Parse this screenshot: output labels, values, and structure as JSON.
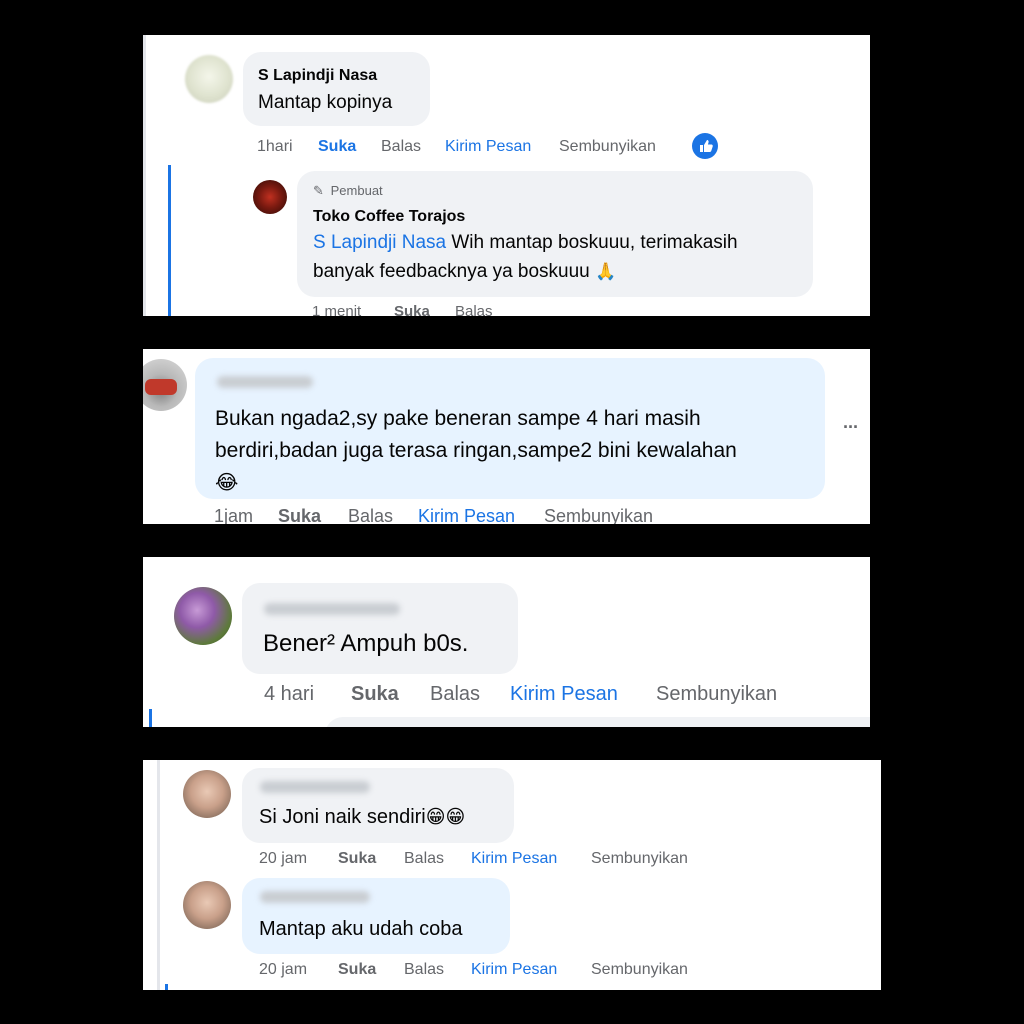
{
  "panel1": {
    "comment": {
      "author": "S Lapindji Nasa",
      "text": "Mantap kopinya",
      "actions": {
        "time": "1hari",
        "like": "Suka",
        "reply": "Balas",
        "message": "Kirim Pesan",
        "hide": "Sembunyikan"
      }
    },
    "reply": {
      "badge": "Pembuat",
      "author": "Toko Coffee Torajos",
      "mention": "S Lapindji Nasa",
      "text_line1": " Wih mantap boskuuu, terimakasih",
      "text_line2": "banyak feedbacknya ya boskuuu",
      "emoji": "🙏",
      "actions": {
        "time": "1 menit",
        "like": "Suka",
        "reply": "Balas"
      }
    }
  },
  "panel2": {
    "comment": {
      "text_line1": "Bukan ngada2,sy pake beneran sampe 4 hari masih",
      "text_line2": "berdiri,badan juga terasa ringan,sampe2 bini kewalahan",
      "emoji": "😂",
      "more": "···",
      "actions": {
        "time": "1jam",
        "like": "Suka",
        "reply": "Balas",
        "message": "Kirim Pesan",
        "hide": "Sembunyikan"
      }
    }
  },
  "panel3": {
    "comment": {
      "text": "Bener² Ampuh b0s.",
      "actions": {
        "time": "4 hari",
        "like": "Suka",
        "reply": "Balas",
        "message": "Kirim Pesan",
        "hide": "Sembunyikan"
      }
    }
  },
  "panel4": {
    "comment1": {
      "text": "Si Joni naik sendiri",
      "emoji": "😁😁",
      "actions": {
        "time": "20 jam",
        "like": "Suka",
        "reply": "Balas",
        "message": "Kirim Pesan",
        "hide": "Sembunyikan"
      }
    },
    "comment2": {
      "text": "Mantap aku udah coba",
      "actions": {
        "time": "20 jam",
        "like": "Suka",
        "reply": "Balas",
        "message": "Kirim Pesan",
        "hide": "Sembunyikan"
      }
    }
  },
  "colors": {
    "link": "#1b74e4",
    "muted": "#65676b",
    "bubble_gray": "#f0f2f5",
    "bubble_blue": "#e7f3ff"
  }
}
